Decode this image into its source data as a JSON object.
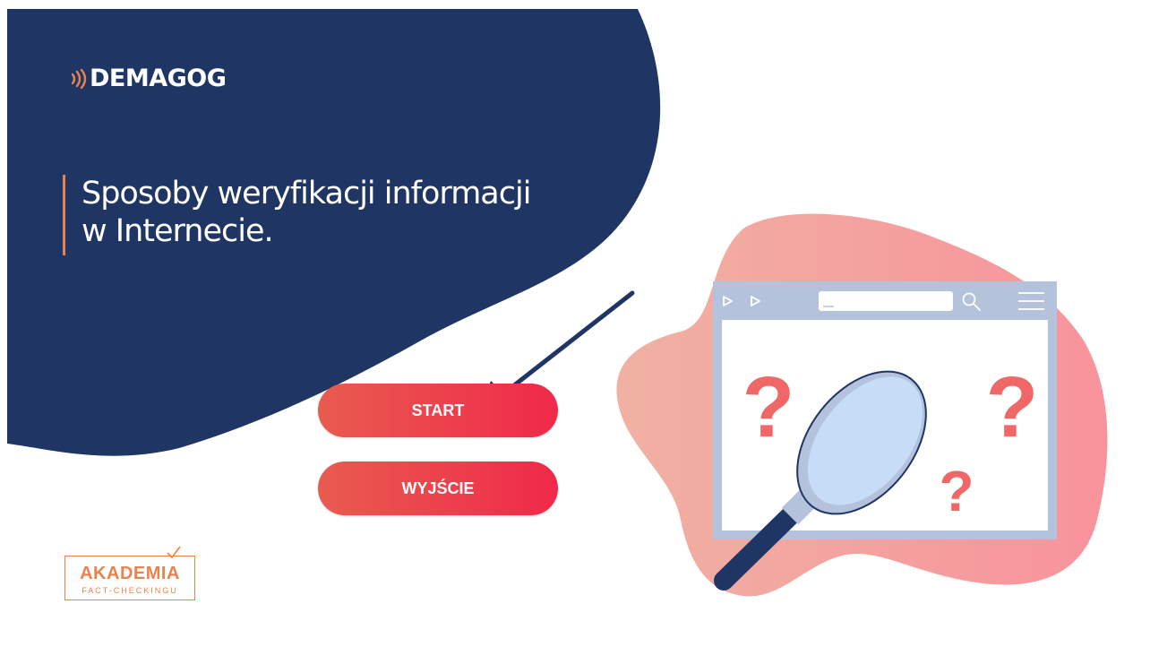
{
  "brand": {
    "logo_text": "DEMAGOG",
    "accent_color": "#e8834d",
    "navy_color": "#1f3564"
  },
  "hero": {
    "headline_line1": "Sposoby weryfikacji informacji",
    "headline_line2": "w Internecie."
  },
  "buttons": {
    "start_label": "START",
    "exit_label": "WYJŚCIE",
    "gradient_start": "#e85c4f",
    "gradient_end": "#f0294a"
  },
  "footer_badge": {
    "title": "AKADEMIA",
    "subtitle": "FACT-CHECKINGU"
  },
  "illustration": {
    "icons": [
      "back-arrow-icon",
      "forward-arrow-icon",
      "search-icon",
      "menu-icon",
      "magnifying-glass-icon",
      "question-mark-icon"
    ],
    "question_mark": "?"
  }
}
